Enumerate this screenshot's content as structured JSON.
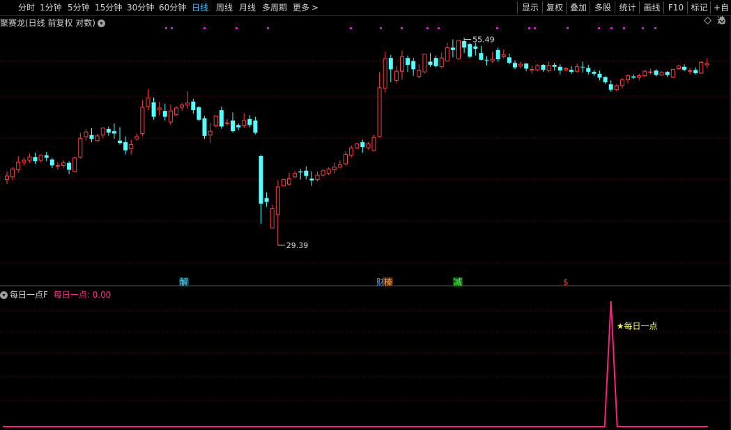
{
  "toolbar": {
    "periods": [
      "分时",
      "1分钟",
      "5分钟",
      "15分钟",
      "30分钟",
      "60分钟",
      "日线",
      "周线",
      "月线",
      "多周期",
      "更多"
    ],
    "active_period": "日线",
    "more_arrow": ">",
    "right_buttons": [
      "显示",
      "复权",
      "叠加",
      "多股",
      "统计",
      "画线",
      "F10",
      "标记",
      "+自选"
    ]
  },
  "main_panel": {
    "title": "聚赛龙(日线 前复权 对数)",
    "collapse_icon": "chevron-down-icon",
    "high_label": "55.49",
    "low_label": "29.39",
    "signals": [
      {
        "text": "解",
        "color": "#4fe0ff",
        "bg": "#143a4a"
      },
      {
        "text": "财",
        "color": "#4fa8ff",
        "bg": ""
      },
      {
        "text": "榛",
        "color": "#ffa040",
        "bg": "#4a2a10"
      },
      {
        "text": "减",
        "color": "#60ff60",
        "bg": "#105a10"
      },
      {
        "text": "$",
        "color": "#ff3030",
        "bg": ""
      }
    ]
  },
  "sub_panel": {
    "indicator_name": "每日一点F",
    "value_label": "每日一点: 0.00",
    "marker_label": "★每日一点",
    "collapse_icon": "chevron-down-icon"
  },
  "colors": {
    "up": "#ff4040",
    "down": "#54ffff",
    "magenta": "#ff00ff",
    "pink_line": "#ff1e82",
    "yellow": "#ffff54",
    "grid": "#6e1414"
  },
  "chart_data": [
    {
      "type": "candlestick",
      "title": "聚赛龙(日线 前复权 对数)",
      "scale": "log",
      "grid": true,
      "y_range": [
        26.5,
        57.5
      ],
      "high": 55.49,
      "low": 29.39,
      "candles": [
        [
          36.0,
          36.9,
          36.4,
          35.5
        ],
        [
          36.3,
          37.4,
          37.2,
          35.9
        ],
        [
          37.1,
          38.7,
          38.0,
          36.8
        ],
        [
          38.0,
          38.5,
          38.2,
          37.6
        ],
        [
          38.2,
          39.0,
          38.6,
          37.9
        ],
        [
          38.6,
          39.1,
          38.1,
          37.8
        ],
        [
          38.2,
          38.9,
          38.8,
          38.0
        ],
        [
          38.8,
          39.2,
          38.5,
          38.1
        ],
        [
          38.3,
          38.5,
          37.6,
          37.3
        ],
        [
          37.5,
          38.0,
          37.6,
          37.1
        ],
        [
          37.6,
          38.2,
          37.9,
          37.3
        ],
        [
          37.9,
          38.1,
          37.1,
          36.6
        ],
        [
          36.9,
          38.6,
          38.5,
          36.8
        ],
        [
          38.6,
          41.6,
          40.9,
          38.4
        ],
        [
          41.1,
          42.1,
          41.7,
          40.6
        ],
        [
          41.3,
          42.2,
          40.8,
          40.4
        ],
        [
          40.6,
          41.5,
          41.2,
          40.5
        ],
        [
          41.3,
          42.3,
          42.2,
          40.9
        ],
        [
          42.1,
          42.4,
          41.6,
          41.2
        ],
        [
          41.8,
          42.8,
          41.5,
          40.8
        ],
        [
          40.6,
          42.3,
          40.3,
          40.1
        ],
        [
          40.4,
          41.1,
          39.4,
          38.9
        ],
        [
          39.6,
          40.7,
          40.1,
          38.9
        ],
        [
          40.8,
          41.5,
          41.1,
          40.6
        ],
        [
          41.5,
          46.0,
          45.0,
          41.2
        ],
        [
          45.1,
          47.6,
          46.3,
          44.6
        ],
        [
          45.7,
          46.4,
          43.7,
          43.3
        ],
        [
          44.7,
          45.8,
          44.9,
          43.9
        ],
        [
          44.5,
          45.5,
          43.7,
          43.2
        ],
        [
          43.0,
          45.4,
          44.5,
          42.6
        ],
        [
          44.0,
          45.2,
          44.9,
          43.8
        ],
        [
          45.0,
          45.6,
          45.3,
          44.5
        ],
        [
          45.3,
          47.3,
          45.6,
          44.8
        ],
        [
          45.8,
          46.2,
          44.6,
          44.1
        ],
        [
          45.0,
          45.2,
          43.3,
          43.1
        ],
        [
          43.5,
          43.8,
          41.2,
          40.8
        ],
        [
          41.3,
          42.9,
          41.8,
          40.3
        ],
        [
          42.5,
          43.9,
          43.8,
          42.3
        ],
        [
          44.6,
          45.1,
          42.4,
          42.1
        ],
        [
          42.8,
          43.4,
          42.9,
          42.5
        ],
        [
          43.2,
          44.3,
          41.8,
          41.6
        ],
        [
          42.6,
          42.8,
          42.3,
          41.9
        ],
        [
          42.5,
          44.2,
          43.2,
          42.2
        ],
        [
          43.4,
          43.9,
          42.6,
          42.3
        ],
        [
          43.2,
          43.7,
          41.6,
          41.4
        ],
        [
          38.7,
          38.9,
          33.4,
          31.4
        ],
        [
          34.0,
          34.6,
          33.6,
          33.1
        ],
        [
          31.0,
          33.3,
          32.9,
          31.2
        ],
        [
          32.3,
          35.9,
          35.2,
          29.4
        ],
        [
          35.3,
          36.1,
          36.0,
          35.3
        ],
        [
          35.5,
          36.8,
          36.1,
          35.3
        ],
        [
          36.3,
          37.0,
          36.7,
          36.2
        ],
        [
          36.9,
          37.2,
          36.8,
          36.0
        ],
        [
          37.0,
          37.5,
          36.4,
          36.0
        ],
        [
          36.1,
          36.9,
          35.9,
          35.3
        ],
        [
          36.0,
          36.9,
          36.5,
          35.8
        ],
        [
          36.5,
          37.2,
          37.0,
          36.3
        ],
        [
          36.7,
          37.4,
          37.2,
          36.5
        ],
        [
          37.1,
          37.9,
          37.4,
          36.7
        ],
        [
          37.4,
          38.2,
          37.7,
          37.3
        ],
        [
          37.8,
          39.3,
          38.9,
          37.6
        ],
        [
          38.8,
          40.0,
          39.7,
          38.5
        ],
        [
          39.7,
          40.3,
          40.2,
          39.5
        ],
        [
          40.4,
          40.7,
          39.8,
          39.1
        ],
        [
          39.7,
          40.4,
          40.2,
          39.5
        ],
        [
          39.4,
          41.3,
          41.0,
          39.3
        ],
        [
          41.1,
          50.2,
          47.8,
          41.0
        ],
        [
          47.7,
          53.4,
          52.3,
          47.1
        ],
        [
          52.4,
          52.9,
          50.6,
          48.6
        ],
        [
          48.9,
          51.1,
          50.3,
          48.5
        ],
        [
          50.3,
          53.6,
          52.6,
          49.0
        ],
        [
          52.4,
          52.8,
          51.3,
          50.2
        ],
        [
          51.9,
          52.4,
          50.6,
          49.6
        ],
        [
          49.5,
          51.4,
          50.4,
          49.2
        ],
        [
          50.2,
          52.9,
          53.0,
          50.0
        ],
        [
          51.8,
          53.2,
          51.3,
          51.0
        ],
        [
          52.4,
          52.8,
          51.1,
          50.9
        ],
        [
          51.0,
          53.3,
          52.4,
          50.8
        ],
        [
          51.9,
          54.9,
          54.1,
          51.8
        ],
        [
          54.1,
          55.5,
          53.7,
          52.5
        ],
        [
          52.3,
          55.3,
          55.3,
          52.1
        ],
        [
          55.2,
          55.8,
          54.1,
          53.2
        ],
        [
          54.7,
          54.9,
          52.6,
          52.4
        ],
        [
          54.3,
          54.9,
          53.9,
          52.8
        ],
        [
          53.2,
          54.4,
          52.1,
          52.0
        ],
        [
          52.1,
          52.7,
          52.0,
          51.2
        ],
        [
          51.9,
          53.4,
          52.2,
          51.6
        ],
        [
          53.7,
          54.1,
          52.2,
          51.8
        ],
        [
          52.6,
          53.8,
          52.9,
          52.3
        ],
        [
          52.5,
          53.1,
          51.6,
          51.4
        ],
        [
          51.6,
          52.0,
          50.9,
          50.6
        ],
        [
          51.1,
          51.8,
          51.4,
          50.8
        ],
        [
          51.5,
          51.6,
          50.7,
          50.3
        ],
        [
          50.6,
          51.2,
          50.6,
          49.9
        ],
        [
          50.5,
          51.4,
          51.2,
          50.3
        ],
        [
          51.3,
          51.4,
          50.5,
          50.2
        ],
        [
          50.4,
          51.8,
          51.2,
          50.1
        ],
        [
          51.3,
          51.6,
          51.0,
          50.4
        ],
        [
          51.0,
          51.4,
          50.4,
          49.8
        ],
        [
          50.5,
          50.9,
          50.7,
          50.3
        ],
        [
          50.5,
          51.1,
          50.2,
          49.9
        ],
        [
          50.3,
          51.5,
          51.0,
          50.1
        ],
        [
          51.0,
          51.8,
          50.9,
          50.1
        ],
        [
          50.8,
          51.3,
          50.2,
          49.8
        ],
        [
          50.2,
          50.5,
          49.9,
          49.6
        ],
        [
          49.9,
          50.4,
          49.3,
          48.9
        ],
        [
          49.4,
          49.5,
          48.6,
          48.4
        ],
        [
          48.3,
          48.9,
          47.5,
          47.2
        ],
        [
          47.5,
          48.3,
          48.1,
          47.3
        ],
        [
          48.1,
          49.3,
          49.0,
          47.7
        ],
        [
          49.0,
          49.8,
          49.6,
          48.5
        ],
        [
          49.5,
          49.8,
          49.3,
          49.1
        ],
        [
          49.4,
          49.9,
          49.6,
          48.9
        ],
        [
          49.6,
          50.5,
          50.3,
          49.4
        ],
        [
          50.2,
          50.7,
          50.2,
          49.8
        ],
        [
          50.4,
          50.6,
          49.7,
          49.5
        ],
        [
          49.7,
          50.3,
          50.1,
          49.6
        ],
        [
          50.2,
          50.3,
          49.7,
          49.4
        ],
        [
          49.4,
          50.7,
          50.6,
          49.2
        ],
        [
          50.7,
          51.3,
          51.1,
          50.5
        ],
        [
          51.0,
          51.4,
          50.5,
          50.3
        ],
        [
          50.4,
          50.8,
          50.4,
          49.8
        ],
        [
          50.5,
          50.9,
          50.0,
          49.8
        ],
        [
          50.0,
          51.9,
          51.7,
          49.9
        ],
        [
          51.3,
          52.4,
          51.5,
          50.8
        ]
      ]
    },
    {
      "type": "line",
      "name": "每日一点",
      "values": [
        0,
        0,
        0,
        0,
        0,
        0,
        0,
        0,
        0,
        0,
        0,
        0,
        0,
        0,
        0,
        0,
        0,
        0,
        0,
        0,
        0,
        0,
        0,
        0,
        0,
        0,
        0,
        0,
        0,
        0,
        0,
        0,
        0,
        0,
        0,
        0,
        0,
        0,
        0,
        0,
        0,
        0,
        0,
        0,
        0,
        0,
        0,
        0,
        0,
        0,
        0,
        0,
        0,
        0,
        0,
        0,
        0,
        0,
        0,
        0,
        0,
        0,
        0,
        0,
        0,
        0,
        0,
        0,
        0,
        0,
        0,
        0,
        0,
        0,
        0,
        0,
        0,
        0,
        0,
        0,
        0,
        0,
        0,
        0,
        0,
        0,
        0,
        0,
        0,
        0,
        0,
        0,
        0,
        0,
        0,
        0,
        0,
        0,
        0,
        0,
        0,
        0,
        0,
        0,
        0,
        0,
        0,
        0,
        0,
        0,
        0,
        0,
        0,
        0,
        0,
        0,
        0,
        0,
        0,
        0,
        0,
        0,
        0,
        0,
        0,
        0,
        0,
        0,
        0,
        0
      ],
      "peak_index": 107,
      "peak_value": 1
    }
  ]
}
